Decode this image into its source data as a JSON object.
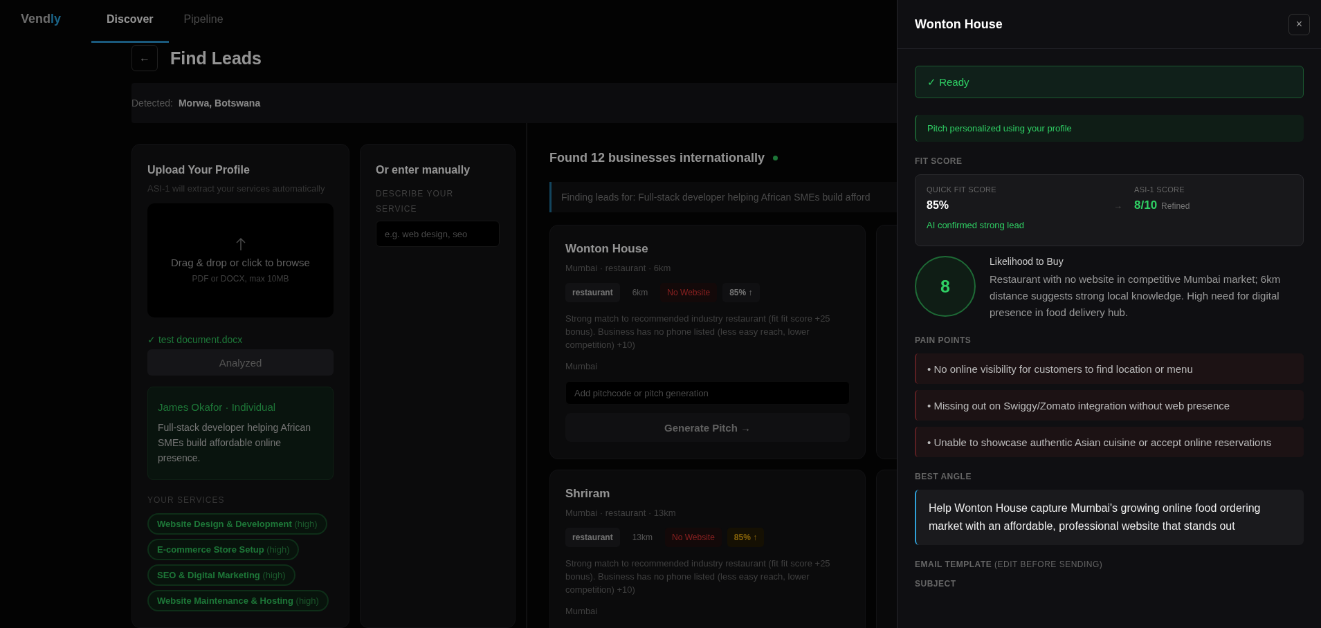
{
  "app": {
    "logo": {
      "text": "Vend",
      "accent": "ly"
    },
    "tabs": [
      {
        "label": "Discover",
        "selected": true
      },
      {
        "label": "Pipeline",
        "selected": false
      }
    ]
  },
  "page": {
    "back": "←",
    "title": "Find Leads",
    "detected_label": "Detected:",
    "detected_value": "Morwa, Botswana"
  },
  "upload": {
    "title": "Upload Your Profile",
    "subtitle": "ASI-1 will extract your services automatically",
    "drop_text": "Drag & drop or click to browse",
    "drop_hint": "PDF or DOCX, max 10MB",
    "file": "✓ test document.docx",
    "button": "Analyzed",
    "profile_name": "James Okafor · Individual",
    "profile_text": "Full-stack developer helping African SMEs build affordable online presence.",
    "services_label": "YOUR SERVICES",
    "services": [
      {
        "name": "Website Design & Development",
        "level": "(high)"
      },
      {
        "name": "E-commerce Store Setup",
        "level": "(high)"
      },
      {
        "name": "SEO & Digital Marketing",
        "level": "(high)"
      },
      {
        "name": "Website Maintenance & Hosting",
        "level": "(high)"
      }
    ]
  },
  "manual": {
    "title": "Or enter manually",
    "label": "DESCRIBE YOUR SERVICE",
    "placeholder": "e.g. web design, seo"
  },
  "results": {
    "title": "Found 12 businesses internationally",
    "banner": "Finding leads for: Full-stack developer helping African SMEs build afford",
    "cards": [
      {
        "name": "Wonton House",
        "meta": "Mumbai · restaurant · 6km",
        "tags": [
          {
            "text": "restaurant",
            "kind": "neutral"
          },
          {
            "text": "6km",
            "kind": "plain"
          },
          {
            "text": "No Website",
            "kind": "danger"
          },
          {
            "text": "85% ↑",
            "kind": "score"
          }
        ],
        "reason": "Strong match to recommended industry restaurant (fit fit score +25 bonus). Business has no phone listed (less easy reach, lower competition) +10)",
        "city": "Mumbai",
        "placeholder": "Add pitchcode or pitch generation",
        "button": "Generate Pitch →"
      },
      {
        "name": "Shriram",
        "meta": "Mumbai · restaurant · 13km",
        "tags": [
          {
            "text": "restaurant",
            "kind": "neutral"
          },
          {
            "text": "13km",
            "kind": "plain"
          },
          {
            "text": "No Website",
            "kind": "danger"
          },
          {
            "text": "85% ↑",
            "kind": "warning"
          }
        ],
        "reason": "Strong match to recommended industry restaurant (fit fit score +25 bonus). Business has no phone listed (less easy reach, lower competition) +10)",
        "city": "Mumbai"
      }
    ]
  },
  "drawer": {
    "title": "Wonton House",
    "close": "×",
    "status": "✓ Ready",
    "note": "Pitch personalized using your profile",
    "fit_label": "FIT SCORE",
    "quick_label": "QUICK FIT SCORE",
    "quick_value": "85%",
    "quick_note": "AI confirmed strong lead",
    "arrow": "→",
    "asi_label": "ASI-1 SCORE",
    "asi_value": "8/10",
    "asi_note": "Refined",
    "likelihood_value": "8",
    "likelihood_title": "Likelihood to Buy",
    "likelihood_text": "Restaurant with no website in competitive Mumbai market; 6km distance suggests strong local knowledge. High need for digital presence in food delivery hub.",
    "pain_label": "PAIN POINTS",
    "pain_points": [
      "• No online visibility for customers to find location or menu",
      "• Missing out on Swiggy/Zomato integration without web presence",
      "• Unable to showcase authentic Asian cuisine or accept online reservations"
    ],
    "angle_label": "BEST ANGLE",
    "angle": "Help Wonton House capture Mumbai's growing online food ordering market with an affordable, professional website that stands out",
    "email_label": "**EMAIL TEMPLATE** (EDIT BEFORE SENDING)",
    "subject_label": "SUBJECT"
  }
}
